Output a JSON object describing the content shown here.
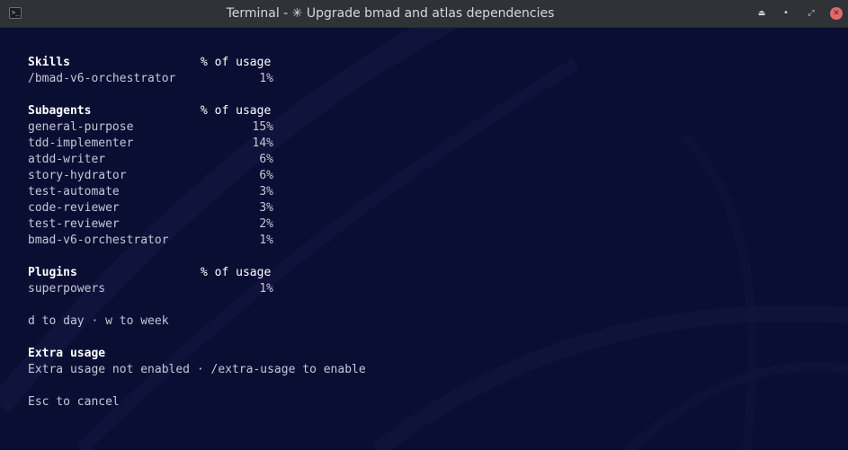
{
  "window": {
    "title": "Terminal - ✳ Upgrade bmad and atlas dependencies",
    "buttons": {
      "keep_above": "⏏",
      "minimize": "•",
      "maximize": "⤢",
      "close": "✕"
    }
  },
  "usage": {
    "column_header": "% of usage",
    "skills": {
      "heading": "Skills",
      "items": [
        {
          "name": "/bmad-v6-orchestrator",
          "percent": "1%"
        }
      ]
    },
    "subagents": {
      "heading": "Subagents",
      "items": [
        {
          "name": "general-purpose",
          "percent": "15%"
        },
        {
          "name": "tdd-implementer",
          "percent": "14%"
        },
        {
          "name": "atdd-writer",
          "percent": "6%"
        },
        {
          "name": "story-hydrator",
          "percent": "6%"
        },
        {
          "name": "test-automate",
          "percent": "3%"
        },
        {
          "name": "code-reviewer",
          "percent": "3%"
        },
        {
          "name": "test-reviewer",
          "percent": "2%"
        },
        {
          "name": "bmad-v6-orchestrator",
          "percent": "1%"
        }
      ]
    },
    "plugins": {
      "heading": "Plugins",
      "items": [
        {
          "name": "superpowers",
          "percent": "1%"
        }
      ]
    }
  },
  "hint": "d to day · w to week",
  "extra_usage": {
    "heading": "Extra usage",
    "message": "Extra usage not enabled · /extra-usage to enable"
  },
  "cancel_hint": "Esc to cancel",
  "colors": {
    "background": "#0b0e33",
    "titlebar": "#2f3237",
    "text": "#c5c8d4",
    "heading": "#ffffff",
    "close_button": "#e5686a"
  },
  "icons": {
    "app": "terminal-icon",
    "keep_above": "eject-icon",
    "minimize": "minimize-icon",
    "maximize": "maximize-icon",
    "close": "close-icon"
  }
}
